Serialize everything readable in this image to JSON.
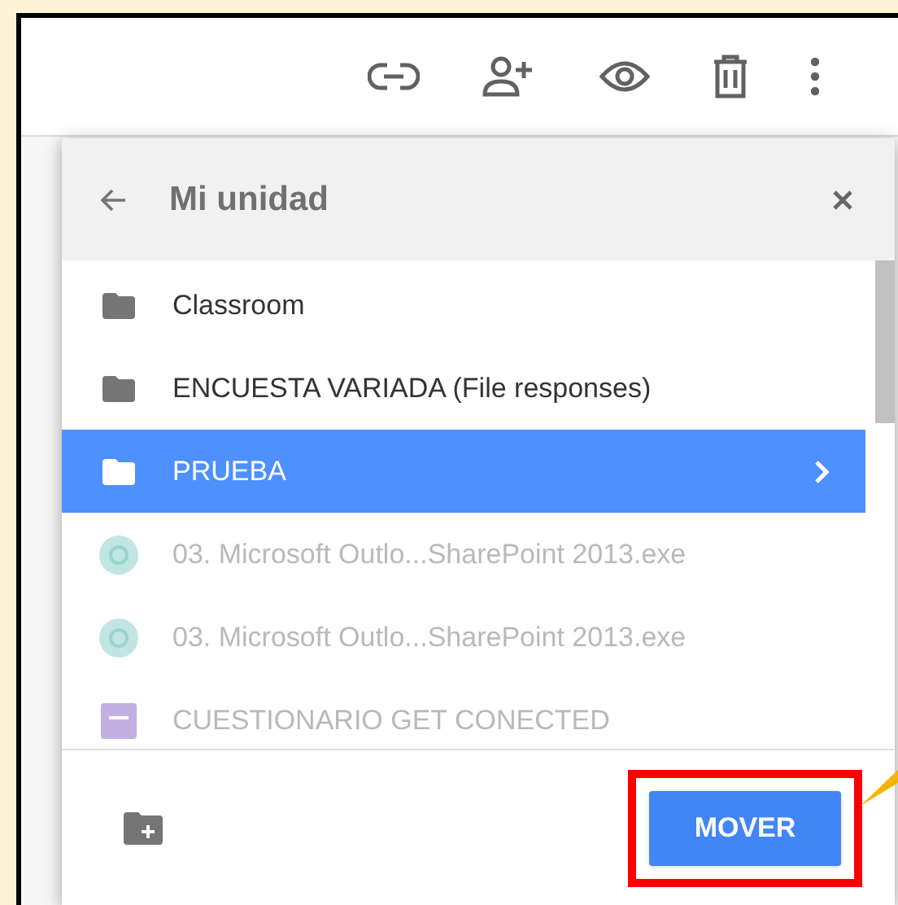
{
  "dialog": {
    "title": "Mi unidad",
    "items": [
      {
        "kind": "folder",
        "name": "Classroom",
        "selected": false,
        "disabled": false
      },
      {
        "kind": "folder",
        "name": "ENCUESTA VARIADA (File responses)",
        "selected": false,
        "disabled": false
      },
      {
        "kind": "folder",
        "name": "PRUEBA",
        "selected": true,
        "disabled": false
      },
      {
        "kind": "file",
        "name": "03. Microsoft Outlo...SharePoint 2013.exe",
        "selected": false,
        "disabled": true
      },
      {
        "kind": "file",
        "name": "03. Microsoft Outlo...SharePoint 2013.exe",
        "selected": false,
        "disabled": true
      },
      {
        "kind": "form",
        "name": "CUESTIONARIO GET CONECTED",
        "selected": false,
        "disabled": true
      }
    ],
    "primary_button": "MOVER",
    "highlighted": true
  }
}
